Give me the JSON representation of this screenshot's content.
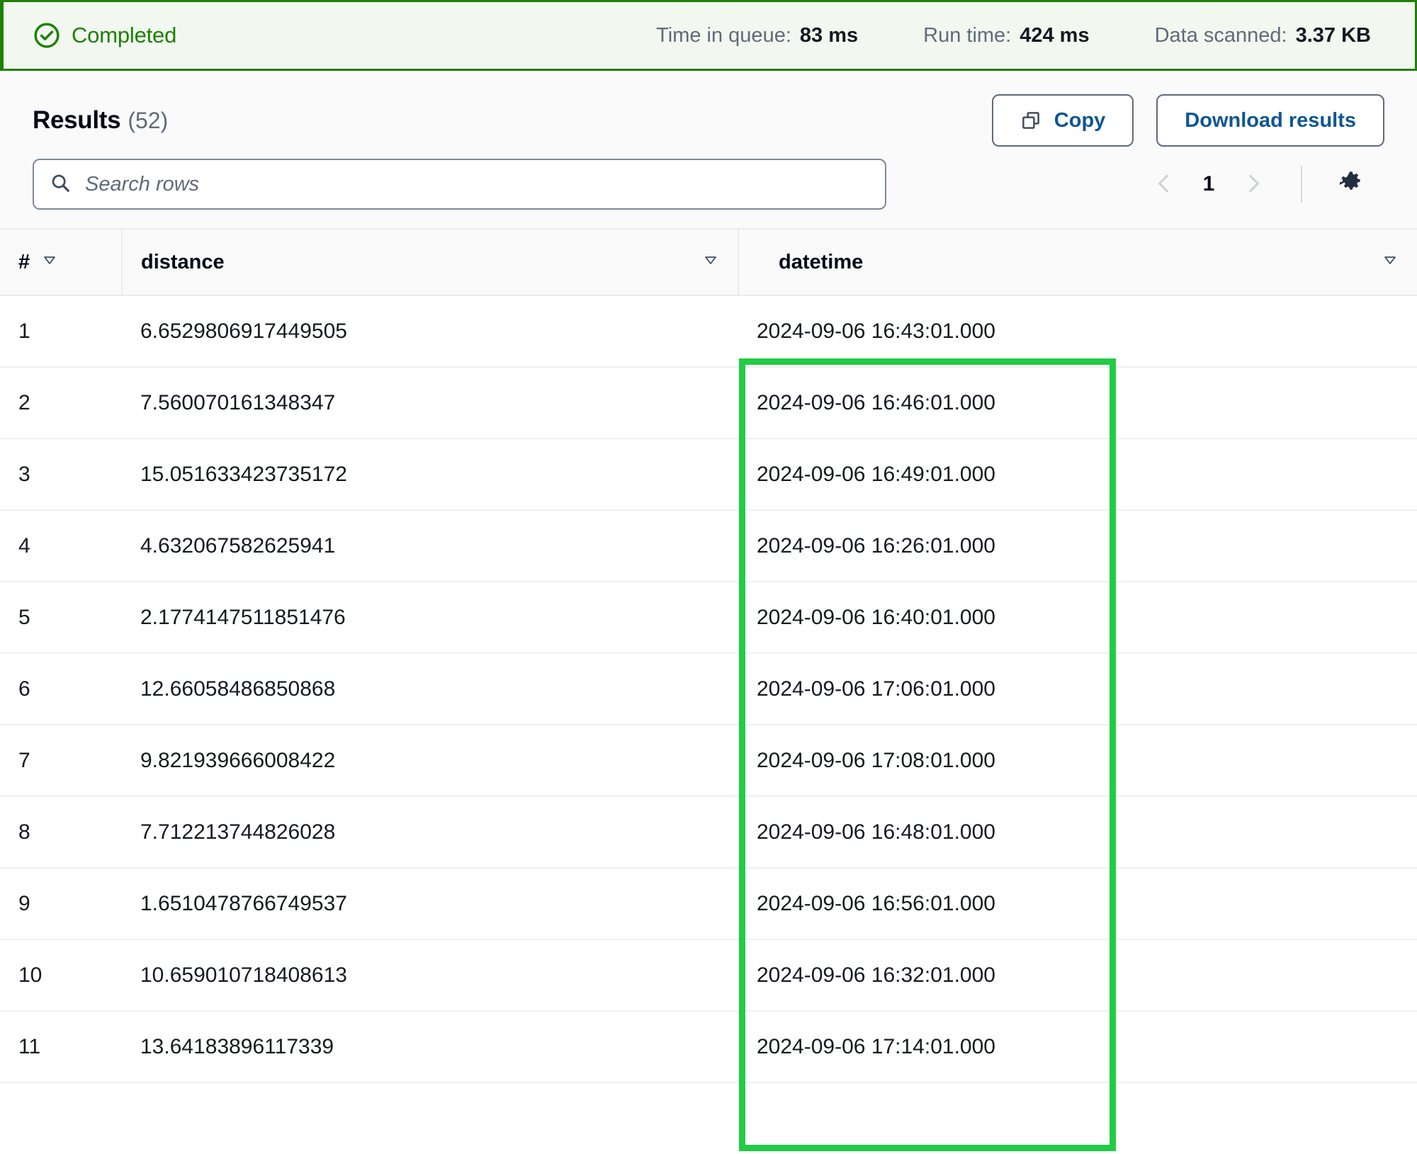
{
  "status": {
    "icon": "status-success-icon",
    "label": "Completed",
    "accent_color": "#1d8102",
    "background_color": "#f2f8f0",
    "metrics": [
      {
        "label": "Time in queue:",
        "value": "83 ms"
      },
      {
        "label": "Run time:",
        "value": "424 ms"
      },
      {
        "label": "Data scanned:",
        "value": "3.37 KB"
      }
    ]
  },
  "results": {
    "title": "Results",
    "count": "(52)",
    "copy_button": "Copy",
    "download_button": "Download results"
  },
  "search": {
    "placeholder": "Search rows",
    "value": ""
  },
  "pagination": {
    "previous_label": "‹",
    "current_page": "1",
    "next_label": "›",
    "preferences_icon": "gear-icon"
  },
  "table": {
    "columns": [
      {
        "label": "#",
        "sort_icon": "sort-descending-icon"
      },
      {
        "label": "distance",
        "sort_icon": "sort-descending-icon"
      },
      {
        "label": "datetime",
        "sort_icon": "sort-descending-icon"
      }
    ],
    "rows": [
      {
        "index": "1",
        "distance": "6.6529806917449505",
        "datetime": "2024-09-06 16:43:01.000"
      },
      {
        "index": "2",
        "distance": "7.560070161348347",
        "datetime": "2024-09-06 16:46:01.000"
      },
      {
        "index": "3",
        "distance": "15.051633423735172",
        "datetime": "2024-09-06 16:49:01.000"
      },
      {
        "index": "4",
        "distance": "4.632067582625941",
        "datetime": "2024-09-06 16:26:01.000"
      },
      {
        "index": "5",
        "distance": "2.1774147511851476",
        "datetime": "2024-09-06 16:40:01.000"
      },
      {
        "index": "6",
        "distance": "12.66058486850868",
        "datetime": "2024-09-06 17:06:01.000"
      },
      {
        "index": "7",
        "distance": "9.821939666008422",
        "datetime": "2024-09-06 17:08:01.000"
      },
      {
        "index": "8",
        "distance": "7.712213744826028",
        "datetime": "2024-09-06 16:48:01.000"
      },
      {
        "index": "9",
        "distance": "1.6510478766749537",
        "datetime": "2024-09-06 16:56:01.000"
      },
      {
        "index": "10",
        "distance": "10.659010718408613",
        "datetime": "2024-09-06 16:32:01.000"
      },
      {
        "index": "11",
        "distance": "13.64183896117339",
        "datetime": "2024-09-06 17:14:01.000"
      }
    ]
  },
  "annotation": {
    "name": "datetime-column-highlight",
    "color": "#22cc44"
  }
}
